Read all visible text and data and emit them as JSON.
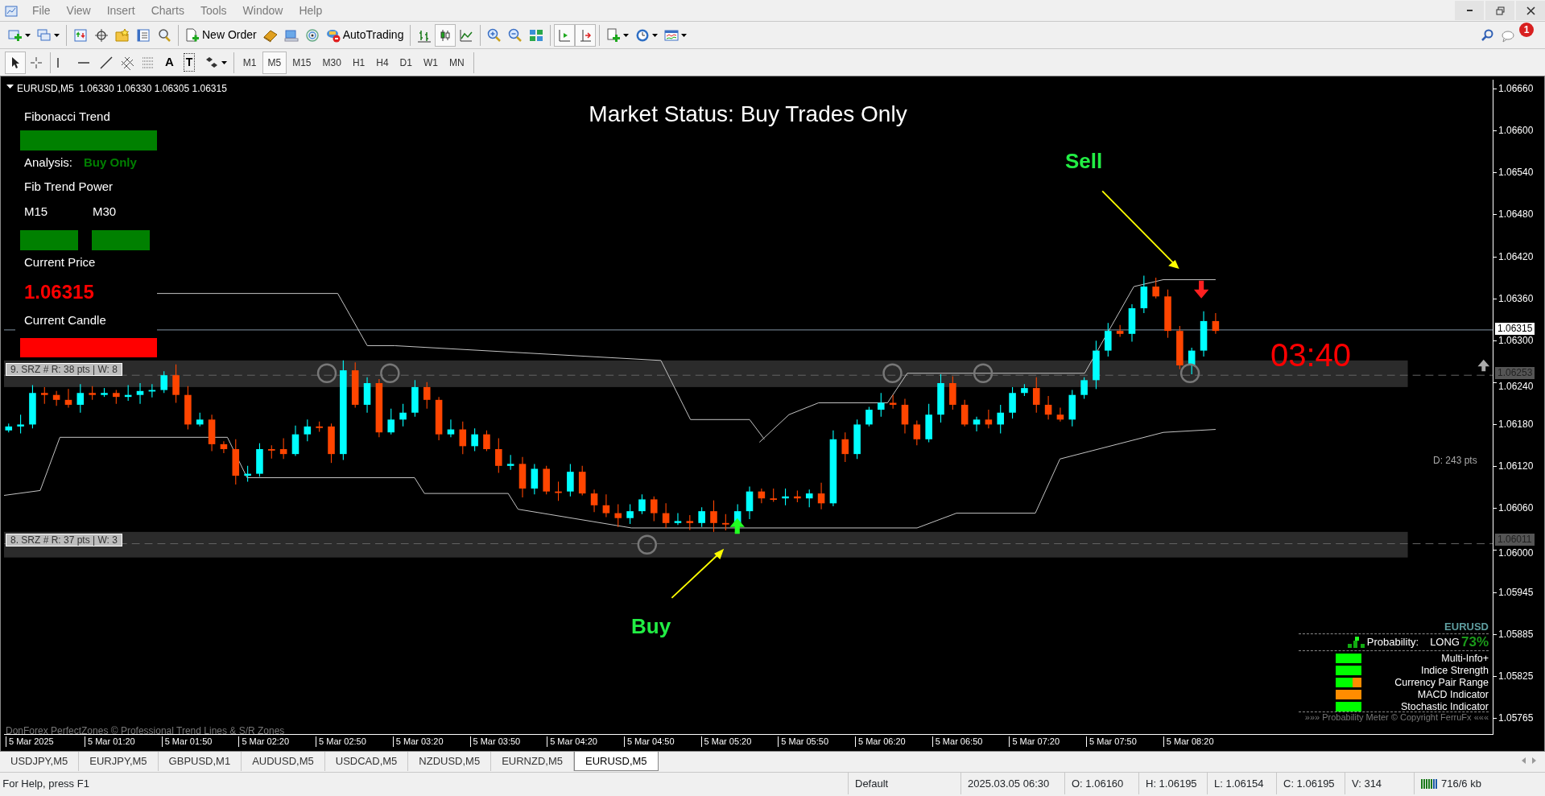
{
  "menu": [
    "File",
    "View",
    "Insert",
    "Charts",
    "Tools",
    "Window",
    "Help"
  ],
  "toolbar1": [
    {
      "kind": "icon",
      "pressed": false,
      "dropdown": true
    },
    {
      "kind": "icon",
      "pressed": false,
      "dropdown": true
    },
    {
      "kind": "separator"
    },
    {
      "kind": "icon",
      "pressed": false
    },
    {
      "kind": "icon",
      "pressed": false
    },
    {
      "kind": "icon",
      "pressed": false
    },
    {
      "kind": "icon",
      "pressed": false
    },
    {
      "kind": "icon",
      "pressed": false
    },
    {
      "kind": "separator"
    },
    {
      "kind": "labeled",
      "label": "New Order",
      "pressed": false
    },
    {
      "kind": "icon",
      "pressed": false
    },
    {
      "kind": "icon",
      "pressed": false
    },
    {
      "kind": "icon",
      "pressed": false
    },
    {
      "kind": "labeled",
      "label": "AutoTrading",
      "pressed": false
    },
    {
      "kind": "separator"
    },
    {
      "kind": "icon",
      "pressed": false
    },
    {
      "kind": "icon",
      "pressed": true
    },
    {
      "kind": "icon",
      "pressed": false
    },
    {
      "kind": "separator"
    },
    {
      "kind": "icon",
      "pressed": false
    },
    {
      "kind": "icon",
      "pressed": false
    },
    {
      "kind": "icon",
      "pressed": false
    },
    {
      "kind": "separator"
    },
    {
      "kind": "icon",
      "pressed": true
    },
    {
      "kind": "icon",
      "pressed": true
    },
    {
      "kind": "separator"
    },
    {
      "kind": "icon",
      "pressed": false,
      "dropdown": true
    },
    {
      "kind": "icon",
      "pressed": false,
      "dropdown": true
    },
    {
      "kind": "icon",
      "pressed": false,
      "dropdown": true
    }
  ],
  "notification_count": "1",
  "toolbar2": [
    {
      "kind": "icon",
      "pressed": true
    },
    {
      "kind": "icon",
      "pressed": false
    },
    {
      "kind": "separator"
    },
    {
      "kind": "icon",
      "pressed": false
    },
    {
      "kind": "icon",
      "pressed": false
    },
    {
      "kind": "icon",
      "pressed": false
    },
    {
      "kind": "icon",
      "pressed": false
    },
    {
      "kind": "icon",
      "pressed": false
    },
    {
      "kind": "text",
      "label": "A",
      "pressed": false
    },
    {
      "kind": "framed",
      "label": "T",
      "pressed": false
    },
    {
      "kind": "icon",
      "pressed": false,
      "dropdown": true
    },
    {
      "kind": "separator"
    }
  ],
  "timeframes": [
    {
      "label": "M1",
      "selected": false
    },
    {
      "label": "M5",
      "selected": true
    },
    {
      "label": "M15",
      "selected": false
    },
    {
      "label": "M30",
      "selected": false
    },
    {
      "label": "H1",
      "selected": false
    },
    {
      "label": "H4",
      "selected": false
    },
    {
      "label": "D1",
      "selected": false
    },
    {
      "label": "W1",
      "selected": false
    },
    {
      "label": "MN",
      "selected": false
    }
  ],
  "chart": {
    "header": "EURUSD,M5  1.06330 1.06330 1.06305 1.06315",
    "market_status": "Market Status: Buy Trades Only",
    "panel": {
      "title": "Fibonacci Trend",
      "trend_bar": {
        "color": "#008000"
      },
      "analysis_label": "Analysis:",
      "analysis_value": "Buy Only",
      "power_label": "Fib Trend Power",
      "timeframes": [
        {
          "label": "M15",
          "color": "#008000"
        },
        {
          "label": "M30",
          "color": "#008000"
        }
      ],
      "price_label": "Current Price",
      "price": "1.06315",
      "candle_label": "Current Candle",
      "candle_bar": {
        "color": "#ff0000"
      }
    },
    "signals": [
      {
        "kind": "sell",
        "label": "Sell"
      },
      {
        "kind": "buy",
        "label": "Buy"
      }
    ],
    "countdown": "03:40",
    "zones": [
      {
        "label": "9. SRZ # R: 38 pts | W: 8",
        "price_tag": "1.06253"
      },
      {
        "label": "8. SRZ # R: 37 pts | W: 3",
        "price_tag": "1.06011"
      }
    ],
    "current_price_tag": "1.06315",
    "distance": "D: 243 pts",
    "footer_note": "DonForex PerfectZones © Professional Trend Lines & S/R Zones",
    "meter": {
      "symbol": "EURUSD",
      "probability_label": "Probability:",
      "direction": "LONG",
      "percent": "73%",
      "rows": [
        {
          "label": "Multi-Info+",
          "level": 1
        },
        {
          "label": "Indice Strength",
          "level": 1
        },
        {
          "label": "Currency Pair Range",
          "level": 0.65
        },
        {
          "label": "MACD Indicator",
          "level": 0
        },
        {
          "label": "Stochastic Indicator",
          "level": 1
        }
      ],
      "footer": "»»» Probability Meter © Copyright FerruFx «««"
    },
    "price_axis": [
      "1.06660",
      "1.06600",
      "1.06540",
      "1.06480",
      "1.06420",
      "1.06360",
      "1.06300",
      "1.06240",
      "1.06180",
      "1.06120",
      "1.06060",
      "1.06000",
      "1.05945",
      "1.05885",
      "1.05825",
      "1.05765"
    ],
    "time_axis": [
      "5 Mar 2025",
      "5 Mar 01:20",
      "5 Mar 01:50",
      "5 Mar 02:20",
      "5 Mar 02:50",
      "5 Mar 03:20",
      "5 Mar 03:50",
      "5 Mar 04:20",
      "5 Mar 04:50",
      "5 Mar 05:20",
      "5 Mar 05:50",
      "5 Mar 06:20",
      "5 Mar 06:50",
      "5 Mar 07:20",
      "5 Mar 07:50",
      "5 Mar 08:20"
    ]
  },
  "tabs": [
    {
      "label": "USDJPY,M5",
      "selected": false
    },
    {
      "label": "EURJPY,M5",
      "selected": false
    },
    {
      "label": "GBPUSD,M1",
      "selected": false
    },
    {
      "label": "AUDUSD,M5",
      "selected": false
    },
    {
      "label": "USDCAD,M5",
      "selected": false
    },
    {
      "label": "NZDUSD,M5",
      "selected": false
    },
    {
      "label": "EURNZD,M5",
      "selected": false
    },
    {
      "label": "EURUSD,M5",
      "selected": true
    }
  ],
  "status_bar": {
    "help": "For Help, press F1",
    "profile": "Default",
    "datetime": "2025.03.05 06:30",
    "open": "O: 1.06160",
    "high": "H: 1.06195",
    "low": "L: 1.06154",
    "close": "C: 1.06195",
    "volume": "V: 314",
    "traffic": "716/6 kb"
  }
}
